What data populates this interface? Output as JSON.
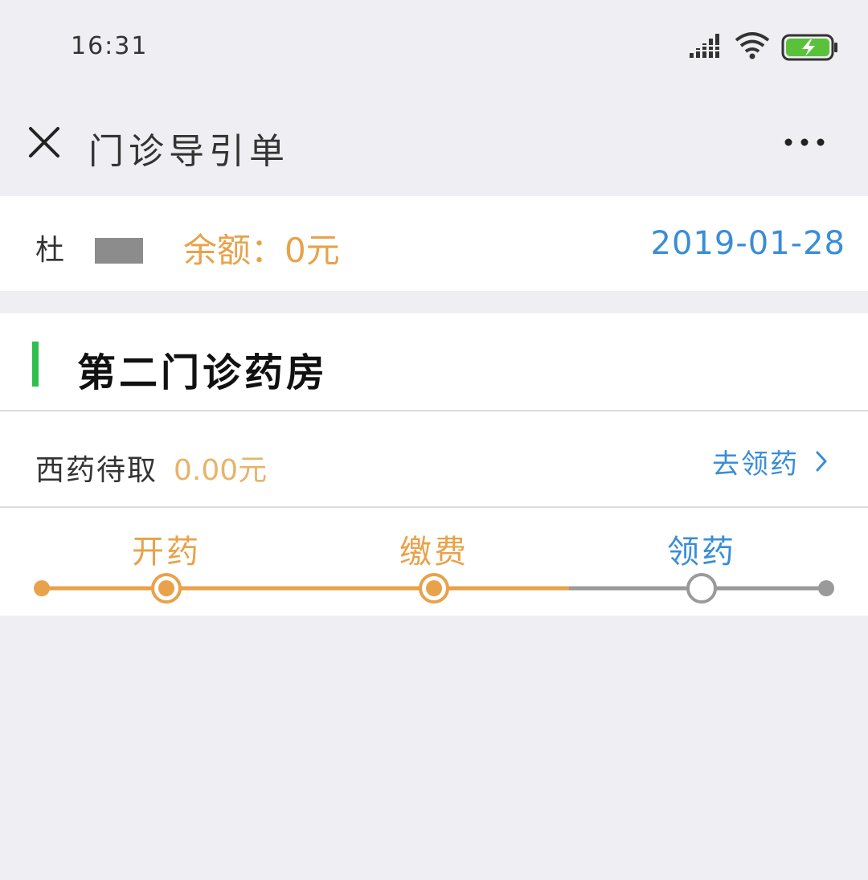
{
  "status_bar": {
    "time": "16:31",
    "icons": [
      "signal-icon",
      "wifi-icon",
      "battery-charging-icon"
    ],
    "battery_color": "#5ac13a"
  },
  "title_bar": {
    "title": "门诊导引单",
    "left_icon": "close-icon",
    "right_icon": "more-icon"
  },
  "patient": {
    "name": "杜",
    "balance_label": "余额：",
    "balance_value": "0元",
    "date": "2019-01-28"
  },
  "pharmacy": {
    "title": "第二门诊药房",
    "accent_color": "#2fbf4e",
    "medicine_label": "西药待取",
    "medicine_amount": "0.00元",
    "action_label": "去领药",
    "action_icon": "chevron-right-icon",
    "steps": [
      {
        "label": "开药",
        "state": "done"
      },
      {
        "label": "缴费",
        "state": "done"
      },
      {
        "label": "领药",
        "state": "current"
      }
    ],
    "colors": {
      "done": "#e8a24a",
      "pending": "#9a9a9a",
      "link": "#3a8dd6"
    }
  }
}
